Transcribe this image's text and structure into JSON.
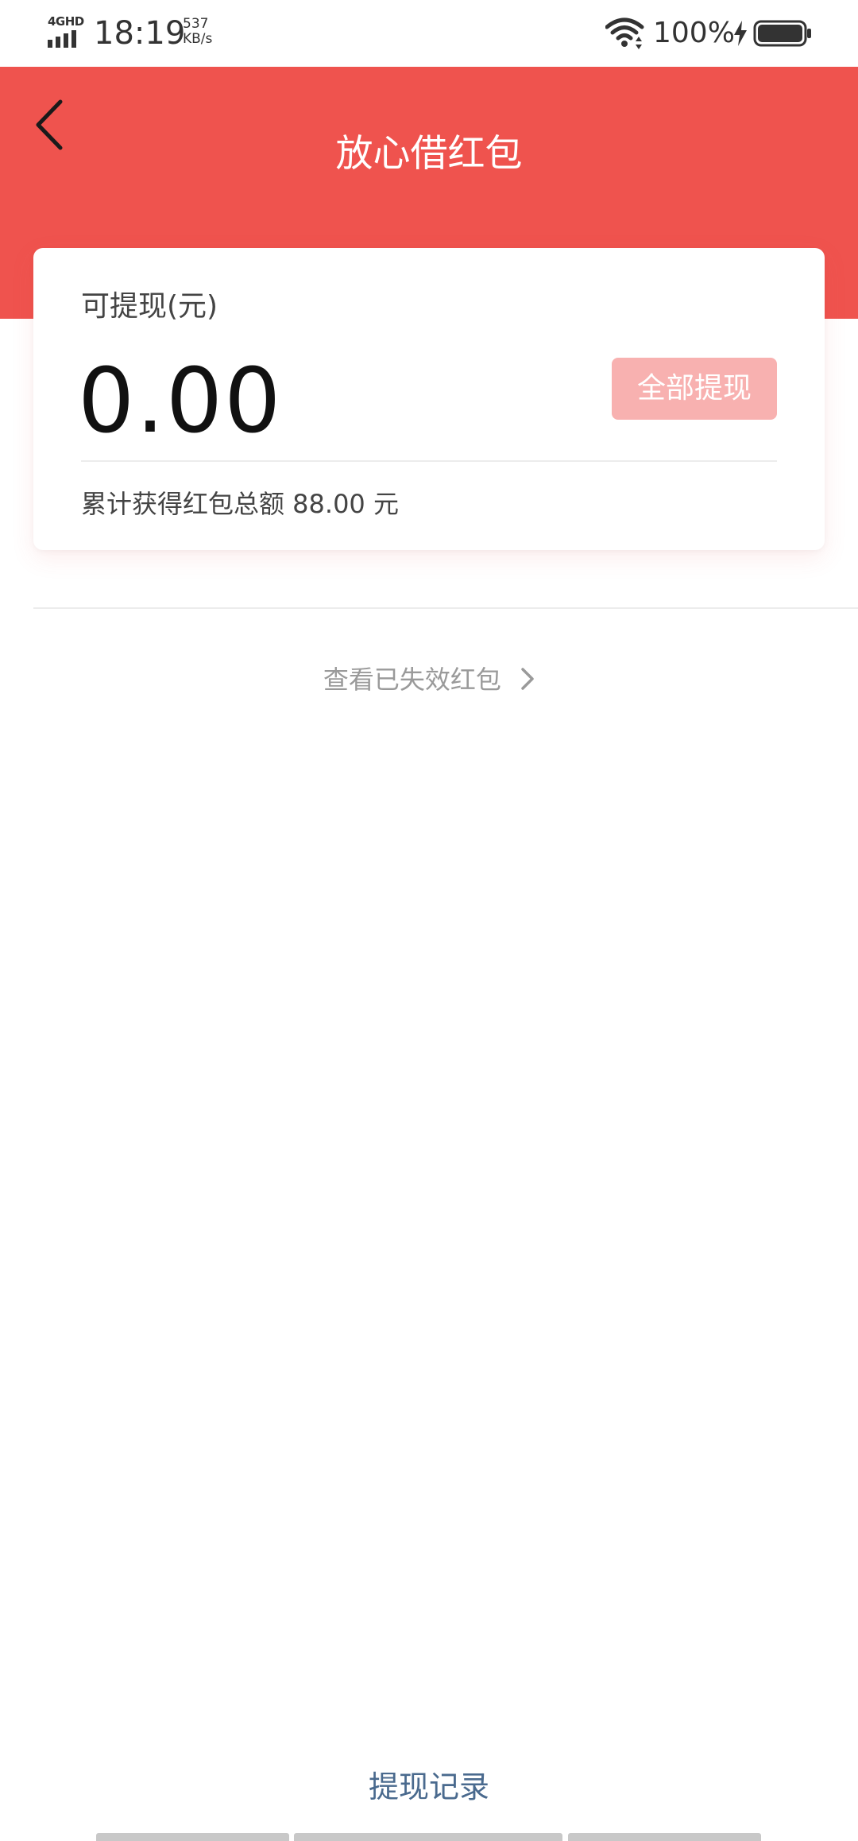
{
  "status_bar": {
    "network": "4GHD",
    "time": "18:19",
    "speed_value": "537",
    "speed_unit": "KB/s",
    "battery_percent": "100%"
  },
  "header": {
    "title": "放心借红包",
    "color": "#ef534e"
  },
  "card": {
    "label": "可提现(元)",
    "amount": "0.00",
    "withdraw_all_label": "全部提现",
    "total_text": "累计获得红包总额 88.00 元"
  },
  "expired_link": {
    "label": "查看已失效红包"
  },
  "history_link": {
    "label": "提现记录"
  }
}
